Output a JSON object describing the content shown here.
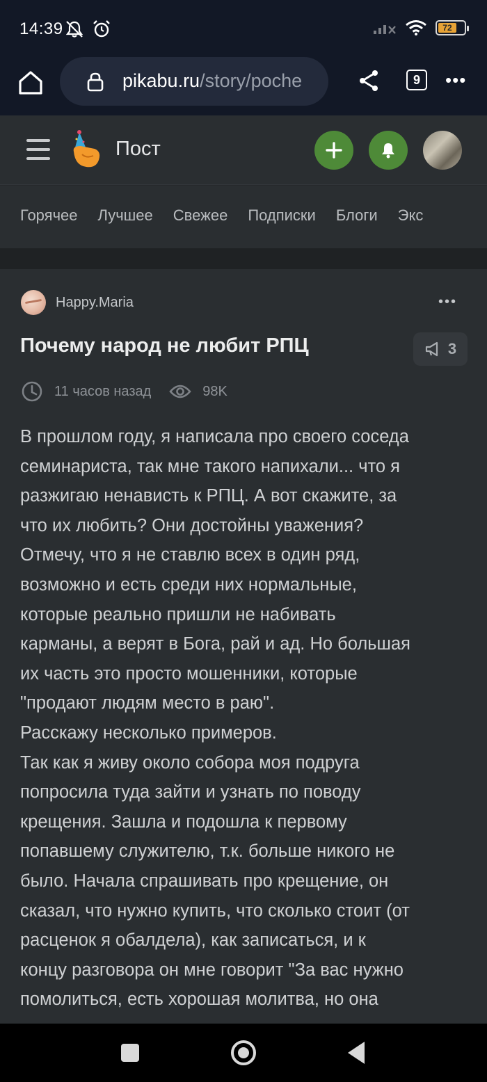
{
  "status_bar": {
    "time": "14:39",
    "battery_level": "72",
    "icons_left": [
      "mute-icon",
      "alarm-icon"
    ],
    "icons_right": [
      "signal-icon",
      "wifi-icon",
      "battery-icon"
    ]
  },
  "browser": {
    "url_host": "pikabu.ru",
    "url_path": "/story/poche",
    "tab_count": "9",
    "more_label": "•••"
  },
  "header": {
    "title": "Пост"
  },
  "nav_tabs": [
    "Горячее",
    "Лучшее",
    "Свежее",
    "Подписки",
    "Блоги",
    "Экс"
  ],
  "post": {
    "author": "Happy.Maria",
    "menu_label": "•••",
    "title": "Почему народ не любит РПЦ",
    "comments_count": "3",
    "time_ago": "11 часов назад",
    "views": "98K",
    "body_lines": [
      "В прошлом году, я написала про своего соседа",
      "семинариста, так мне такого напихали... что я",
      "разжигаю ненависть к РПЦ. А вот скажите, за",
      "что их любить? Они достойны уважения?",
      "Отмечу, что я не ставлю всех в один ряд,",
      "возможно и есть среди них нормальные,",
      "которые реально пришли не набивать",
      "карманы, а верят в Бога, рай и ад. Но большая",
      "их часть это просто мошенники, которые",
      "\"продают людям место в раю\".",
      "Расскажу несколько примеров.",
      "Так как я живу около собора моя подруга",
      "попросила туда зайти и узнать по поводу",
      "крещения. Зашла и подошла к первому",
      "попавшему служителю, т.к. больше никого не",
      "было. Начала спрашивать про крещение, он",
      "сказал, что нужно купить, что сколько стоит (от",
      "расценок я обалдела), как записаться, и к",
      "концу разговора он мне говорит \"За вас нужно",
      "помолиться, есть хорошая молитва, но она"
    ]
  },
  "colors": {
    "bg": "#2a2e31",
    "chrome": "#121826",
    "accent_green": "#4e8a38",
    "text": "#cfd1d3"
  }
}
